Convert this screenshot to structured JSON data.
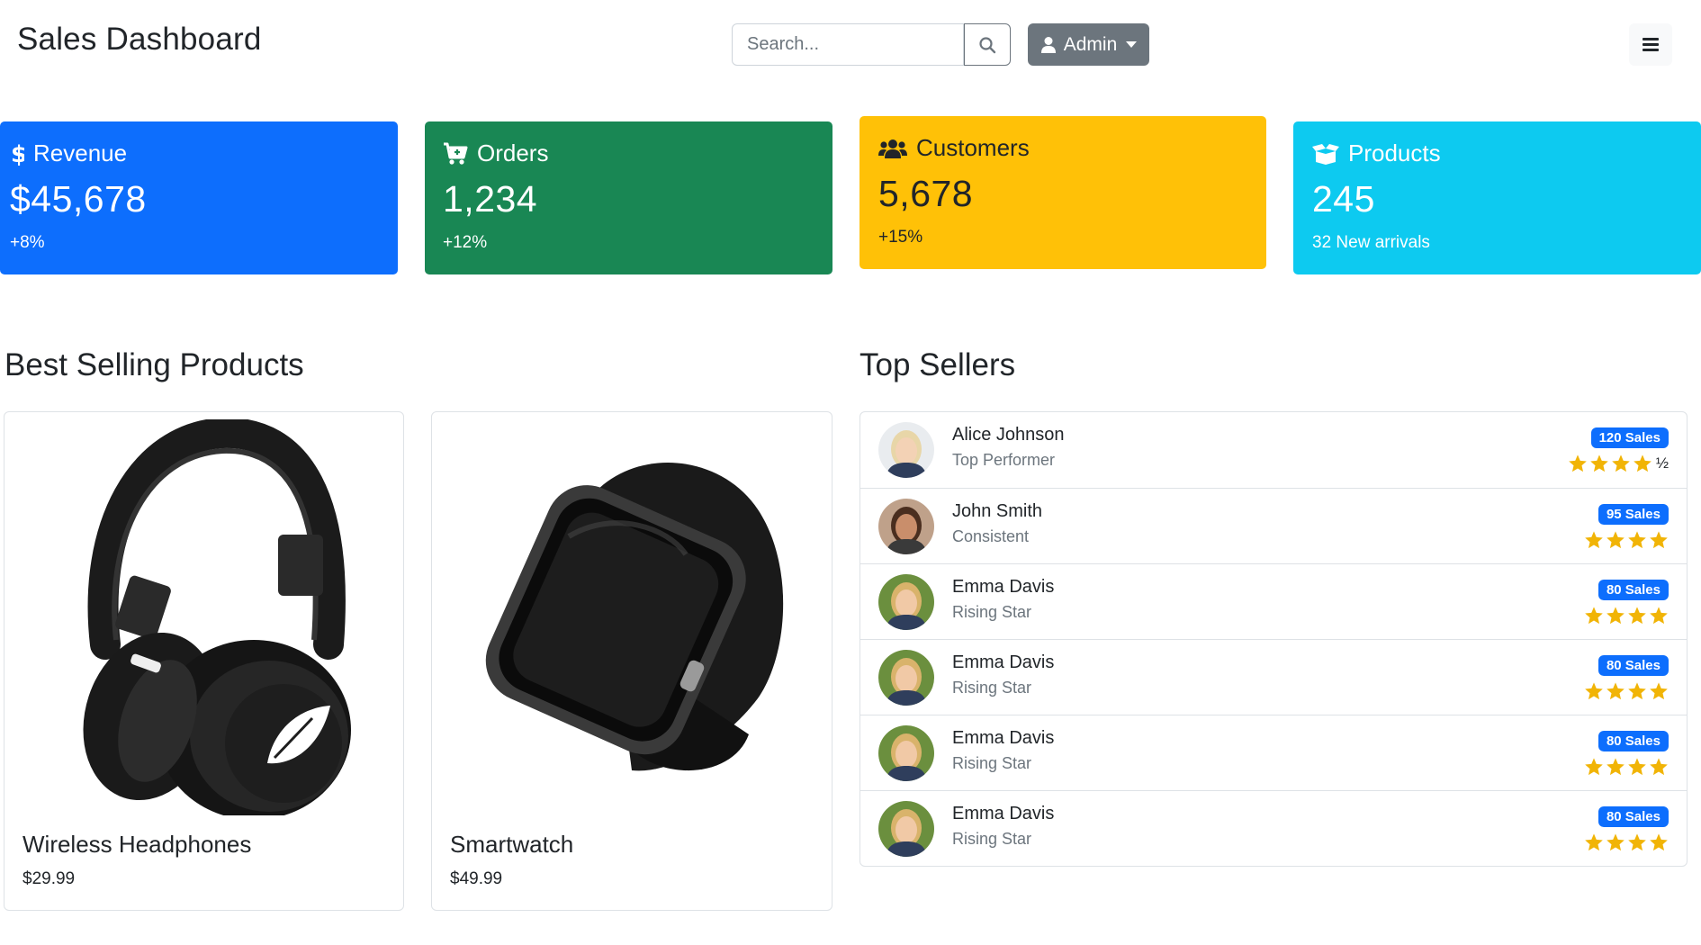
{
  "header": {
    "title": "Sales Dashboard",
    "search_placeholder": "Search...",
    "admin_label": "Admin"
  },
  "stats": [
    {
      "label": "Revenue",
      "value": "$45,678",
      "sub": "+8%",
      "color": "#0d6efd",
      "icon": "dollar-icon"
    },
    {
      "label": "Orders",
      "value": "1,234",
      "sub": "+12%",
      "color": "#198754",
      "icon": "cart-icon"
    },
    {
      "label": "Customers",
      "value": "5,678",
      "sub": "+15%",
      "color": "#ffc107",
      "icon": "users-icon"
    },
    {
      "label": "Products",
      "value": "245",
      "sub": "32 New arrivals",
      "color": "#0dcaf0",
      "icon": "box-open-icon"
    }
  ],
  "best_selling": {
    "title": "Best Selling Products",
    "products": [
      {
        "name": "Wireless Headphones",
        "price": "$29.99",
        "image": "headphones-image"
      },
      {
        "name": "Smartwatch",
        "price": "$49.99",
        "image": "smartwatch-image"
      }
    ]
  },
  "top_sellers": {
    "title": "Top Sellers",
    "sellers": [
      {
        "name": "Alice Johnson",
        "role": "Top Performer",
        "badge": "120 Sales",
        "rating": 4.5,
        "half_label": "½"
      },
      {
        "name": "John Smith",
        "role": "Consistent",
        "badge": "95 Sales",
        "rating": 4
      },
      {
        "name": "Emma Davis",
        "role": "Rising Star",
        "badge": "80 Sales",
        "rating": 4
      },
      {
        "name": "Emma Davis",
        "role": "Rising Star",
        "badge": "80 Sales",
        "rating": 4
      },
      {
        "name": "Emma Davis",
        "role": "Rising Star",
        "badge": "80 Sales",
        "rating": 4
      },
      {
        "name": "Emma Davis",
        "role": "Rising Star",
        "badge": "80 Sales",
        "rating": 4
      }
    ]
  },
  "colors": {
    "accent": "#0d6efd",
    "star": "#f1b406",
    "secondary": "#6c757d"
  }
}
